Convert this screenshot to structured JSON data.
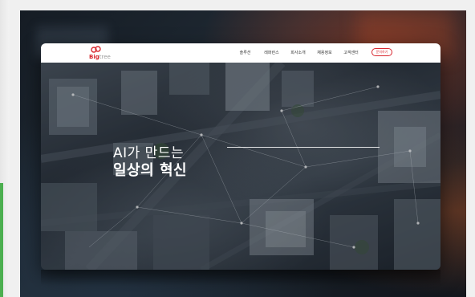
{
  "header": {
    "logo_text_brand": "Big",
    "logo_text_rest": "tree",
    "menu": [
      "솔루션",
      "레퍼런스",
      "회사소개",
      "채용정보",
      "고객센터"
    ],
    "cta_label": "문의하기"
  },
  "hero": {
    "title_line1": "AI가 만드는",
    "title_line2": "일상의 혁신"
  },
  "colors": {
    "brand_red": "#d8262e",
    "page_bg": "#f0f0f0",
    "accent_green": "#4caf50"
  }
}
